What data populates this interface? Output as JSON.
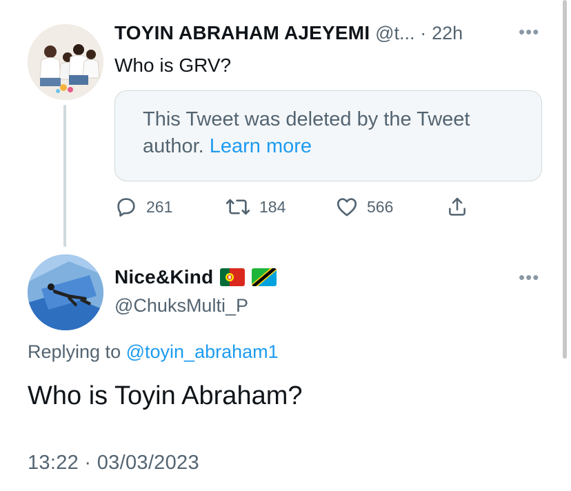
{
  "parent_tweet": {
    "author_name": "TOYIN ABRAHAM AJEYEMI",
    "handle": "@t...",
    "separator": "·",
    "time": "22h",
    "text": "Who is GRV?",
    "deleted_notice": {
      "text": "This Tweet was deleted by the Tweet author.",
      "link_label": "Learn more"
    },
    "actions": {
      "replies": "261",
      "retweets": "184",
      "likes": "566"
    }
  },
  "reply_tweet": {
    "author_name": "Nice&Kind",
    "flags": [
      "portugal-flag",
      "tanzania-flag"
    ],
    "handle": "@ChuksMulti_P",
    "replying_prefix": "Replying to",
    "replying_to": "@toyin_abraham1",
    "text": "Who is Toyin Abraham?",
    "timestamp": "13:22 · 03/03/2023"
  },
  "icons": {
    "more": "more-horizontal-icon",
    "reply": "reply-icon",
    "retweet": "retweet-icon",
    "like": "heart-icon",
    "share": "share-icon"
  },
  "colors": {
    "link": "#1d9bf0",
    "muted": "#536471",
    "text": "#0f1419",
    "card_border": "#cfd9de"
  }
}
